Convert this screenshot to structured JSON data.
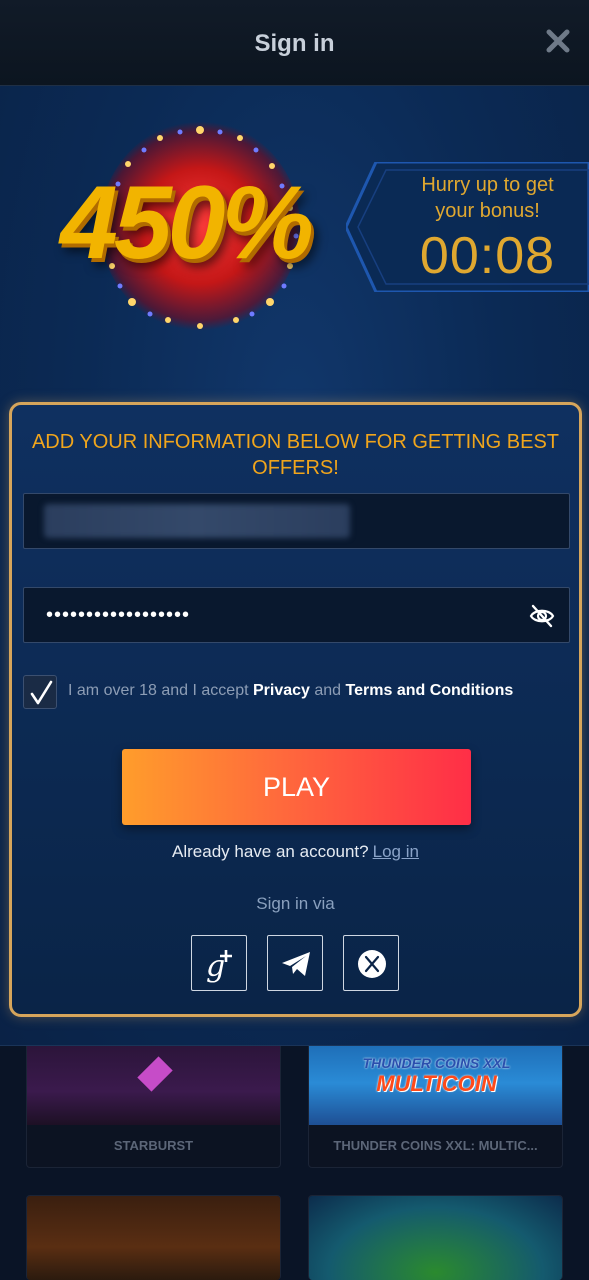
{
  "header": {
    "title": "Sign in",
    "close_icon": "close-icon"
  },
  "bonus": {
    "percent_text": "450%",
    "timer_label_line1": "Hurry up to get",
    "timer_label_line2": "your bonus!",
    "timer_value": "00:08"
  },
  "form": {
    "heading_line1": "ADD YOUR INFORMATION BELOW FOR GETTING BEST",
    "heading_line2": "OFFERS!",
    "password_value": "••••••••••••••••••",
    "consent": {
      "prefix": "I am over 18 and I accept ",
      "privacy": "Privacy",
      "and": " and ",
      "terms": "Terms and Conditions",
      "checked": true
    },
    "play_label": "PLAY",
    "account_prompt": "Already have an account?",
    "login_link": "Log in",
    "via_label": "Sign in via",
    "social": [
      "google-plus-icon",
      "telegram-icon",
      "x-icon"
    ]
  },
  "games": [
    {
      "title": "STARBURST"
    },
    {
      "title": "THUNDER COINS XXL: MULTIC...",
      "logo_line1": "THUNDER COINS XXL",
      "logo_line2": "MULTICOIN"
    },
    {
      "title": ""
    },
    {
      "title": ""
    }
  ],
  "colors": {
    "accent_orange": "#f0a51c",
    "card_border": "#d6a55b",
    "play_start": "#ff9d2b",
    "play_end": "#ff2e47",
    "timer": "#e0a830"
  }
}
